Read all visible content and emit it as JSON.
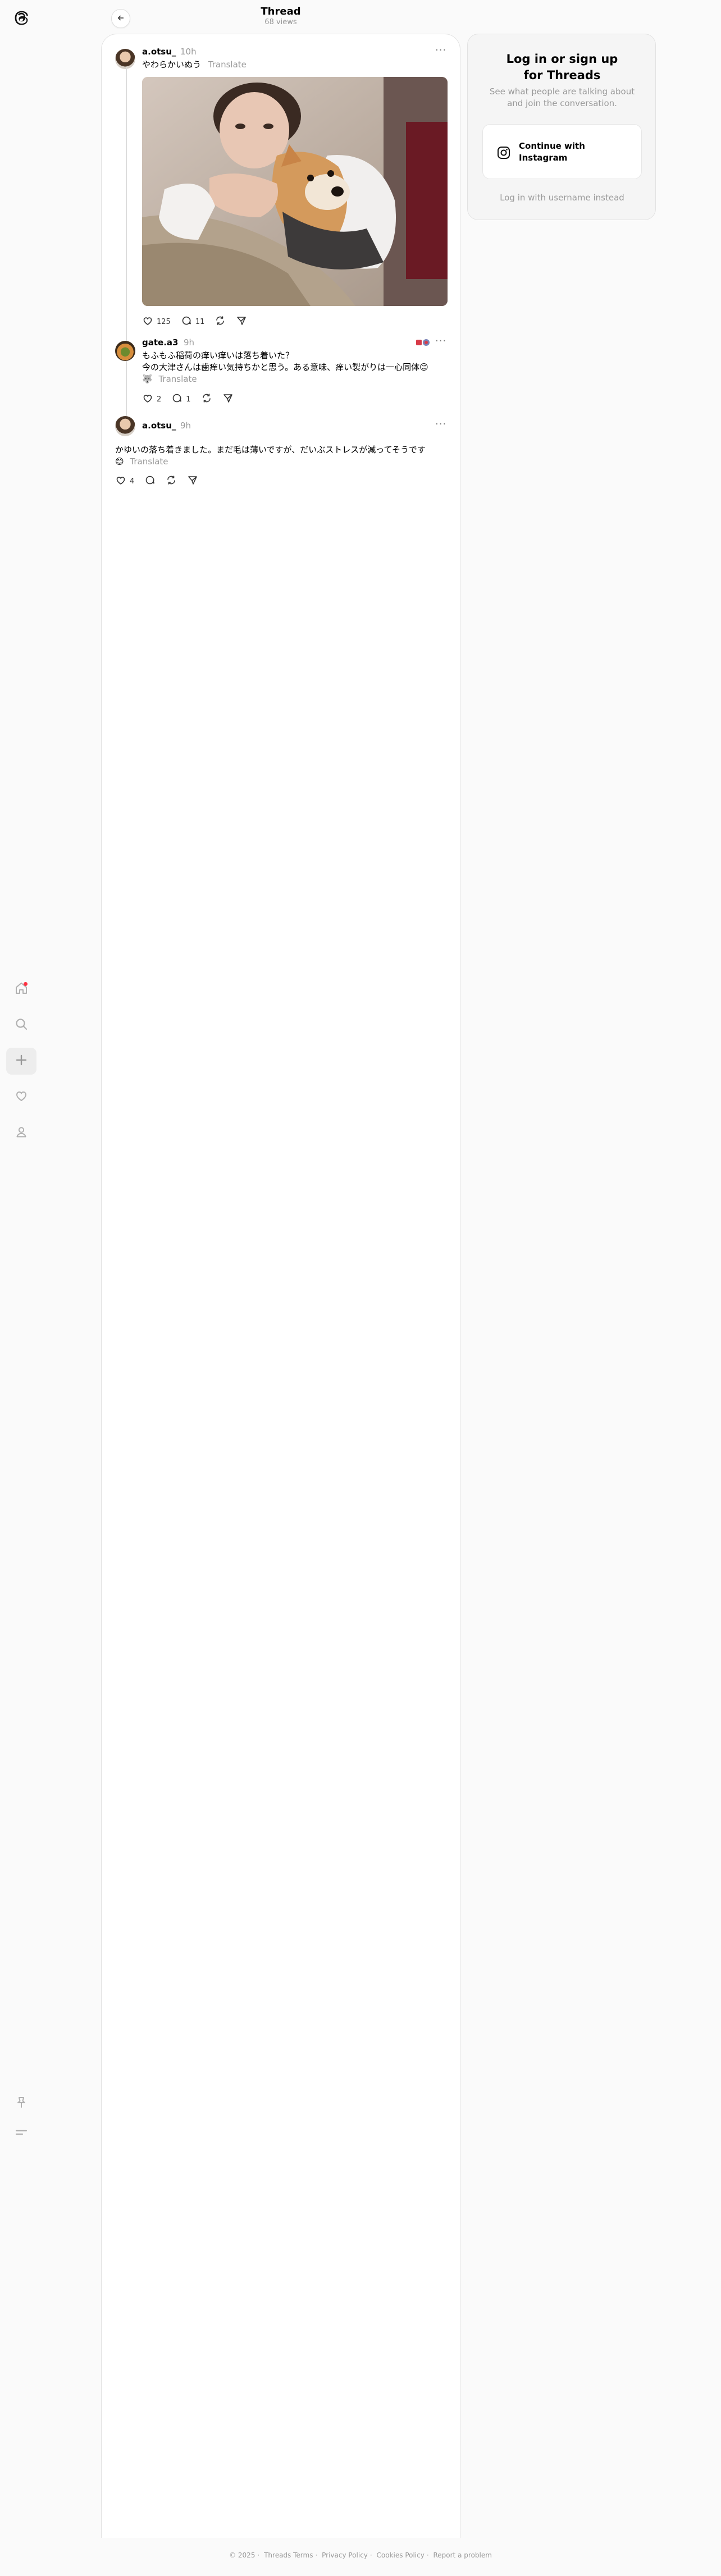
{
  "header": {
    "title": "Thread",
    "views": "68 views"
  },
  "posts": [
    {
      "username": "a.otsu_",
      "time": "10h",
      "text": "やわらかいぬう",
      "translate": "Translate",
      "likes": "125",
      "replies": "11"
    },
    {
      "username": "gate.a3",
      "time": "9h",
      "line1": "もふもふ稲荷の痒い痒いは落ち着いた？",
      "line2": "今の大津さんは歯痒い気持ちかと思う。ある意味、痒い製がりは一心同体😊",
      "line3_prefix": "🐺",
      "translate": "Translate",
      "likes": "2",
      "replies": "1"
    },
    {
      "username": "a.otsu_",
      "time": "9h",
      "line1": "かゆいの落ち着きました。まだ毛は薄いですが、だいぶストレスが減ってそうです",
      "line2_prefix": "😊",
      "translate": "Translate",
      "likes": "4"
    }
  ],
  "login": {
    "title_line1": "Log in or sign up",
    "title_line2": "for Threads",
    "subtitle": "See what people are talking about and join the conversation.",
    "instagram_line1": "Continue with",
    "instagram_line2": "Instagram",
    "alt": "Log in with username instead"
  },
  "footer": {
    "copyright": "© 2025",
    "terms": "Threads Terms",
    "privacy": "Privacy Policy",
    "cookies": "Cookies Policy",
    "report": "Report a problem"
  },
  "icons": {
    "logo": "threads-logo-icon",
    "home": "home-icon",
    "search": "search-icon",
    "create": "plus-icon",
    "activity": "heart-icon",
    "profile": "profile-icon",
    "pin": "pin-icon",
    "menu": "menu-icon"
  },
  "colors": {
    "notification": "#ff3040",
    "muted": "#999999",
    "background": "#fafafa"
  }
}
